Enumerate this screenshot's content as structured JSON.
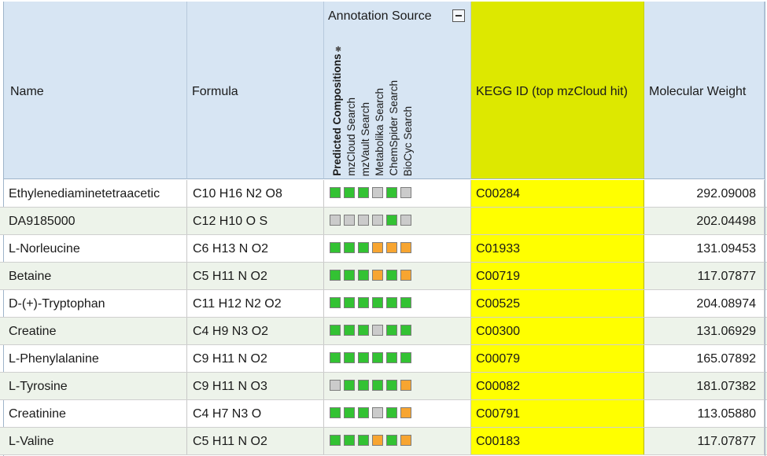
{
  "columns": {
    "name": "Name",
    "formula": "Formula",
    "annotation_source": "Annotation Source",
    "kegg": "KEGG ID (top mzCloud hit)",
    "mw": "Molecular Weight"
  },
  "annotation_subcolumns": [
    "Predicted Compositions",
    "mzCloud Search",
    "mzVault Search",
    "Metabolika Search",
    "ChemSpider Search",
    "BioCyc Search"
  ],
  "status_colors": {
    "green": "#33c233",
    "grey": "#cbcbcb",
    "orange": "#f7a531"
  },
  "rows": [
    {
      "name": "Ethylenediaminetetraacetic",
      "formula": "C10 H16 N2 O8",
      "kegg": "C00284",
      "mw": "292.09008",
      "anno": [
        "green",
        "green",
        "green",
        "grey",
        "green",
        "grey"
      ]
    },
    {
      "name": "DA9185000",
      "formula": "C12 H10 O S",
      "kegg": "",
      "mw": "202.04498",
      "anno": [
        "grey",
        "grey",
        "grey",
        "grey",
        "green",
        "grey"
      ]
    },
    {
      "name": "L-Norleucine",
      "formula": "C6 H13 N O2",
      "kegg": "C01933",
      "mw": "131.09453",
      "anno": [
        "green",
        "green",
        "green",
        "orange",
        "orange",
        "orange"
      ]
    },
    {
      "name": "Betaine",
      "formula": "C5 H11 N O2",
      "kegg": "C00719",
      "mw": "117.07877",
      "anno": [
        "green",
        "green",
        "green",
        "orange",
        "green",
        "orange"
      ]
    },
    {
      "name": "D-(+)-Tryptophan",
      "formula": "C11 H12 N2 O2",
      "kegg": "C00525",
      "mw": "204.08974",
      "anno": [
        "green",
        "green",
        "green",
        "green",
        "green",
        "green"
      ]
    },
    {
      "name": "Creatine",
      "formula": "C4 H9 N3 O2",
      "kegg": "C00300",
      "mw": "131.06929",
      "anno": [
        "green",
        "green",
        "green",
        "grey",
        "green",
        "green"
      ]
    },
    {
      "name": "L-Phenylalanine",
      "formula": "C9 H11 N O2",
      "kegg": "C00079",
      "mw": "165.07892",
      "anno": [
        "green",
        "green",
        "green",
        "green",
        "green",
        "green"
      ]
    },
    {
      "name": "L-Tyrosine",
      "formula": "C9 H11 N O3",
      "kegg": "C00082",
      "mw": "181.07382",
      "anno": [
        "grey",
        "green",
        "green",
        "green",
        "green",
        "orange"
      ]
    },
    {
      "name": "Creatinine",
      "formula": "C4 H7 N3 O",
      "kegg": "C00791",
      "mw": "113.05880",
      "anno": [
        "green",
        "green",
        "green",
        "grey",
        "green",
        "orange"
      ]
    },
    {
      "name": "L-Valine",
      "formula": "C5 H11 N O2",
      "kegg": "C00183",
      "mw": "117.07877",
      "anno": [
        "green",
        "green",
        "green",
        "orange",
        "green",
        "orange"
      ]
    }
  ]
}
